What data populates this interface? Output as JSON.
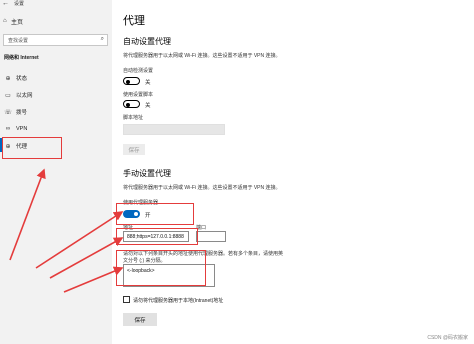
{
  "app": {
    "title": "设置",
    "back_icon": "back-arrow-icon"
  },
  "sidebar": {
    "home": {
      "label": "主页",
      "icon": "home-icon"
    },
    "search": {
      "placeholder": "查找设置",
      "icon": "search-icon"
    },
    "section": "网络和 Internet",
    "items": [
      {
        "label": "状态",
        "icon": "globe-icon"
      },
      {
        "label": "以太网",
        "icon": "monitor-icon"
      },
      {
        "label": "拨号",
        "icon": "phone-icon"
      },
      {
        "label": "VPN",
        "icon": "vpn-icon"
      },
      {
        "label": "代理",
        "icon": "globe-icon",
        "active": true
      }
    ]
  },
  "main": {
    "title": "代理",
    "auto": {
      "heading": "自动设置代理",
      "desc": "将代理服务器用于以太网或 Wi-Fi 连接。这些设置不适用于 VPN 连接。",
      "detect_label": "自动检测设置",
      "detect_state": "关",
      "script_label": "使用设置脚本",
      "script_state": "关",
      "address_label": "脚本地址",
      "save_label": "保存"
    },
    "manual": {
      "heading": "手动设置代理",
      "desc": "将代理服务器用于以太网或 Wi-Fi 连接。这些设置不适用于 VPN 连接。",
      "use_proxy_label": "使用代理服务器",
      "use_proxy_state": "开",
      "address_label": "地址",
      "address_value": "888;https=127.0.0.1:8888",
      "port_label": "端口",
      "port_value": "",
      "exceptions_desc_line1": "请勿对以下列条目开头的地址使用代理服务器。若有多个条目，请使用英",
      "exceptions_desc_line2": "文分号 (;) 来分隔。",
      "exceptions_value": "<-loopback>",
      "local_checkbox_label": "请勿将代理服务器用于本地(Intranet)地址",
      "save_label": "保存"
    }
  },
  "watermark": "CSDN @码农搬家",
  "colors": {
    "accent": "#0067c0",
    "annotation": "#e43c3c",
    "sidebar_bg": "#f2f2f2"
  }
}
